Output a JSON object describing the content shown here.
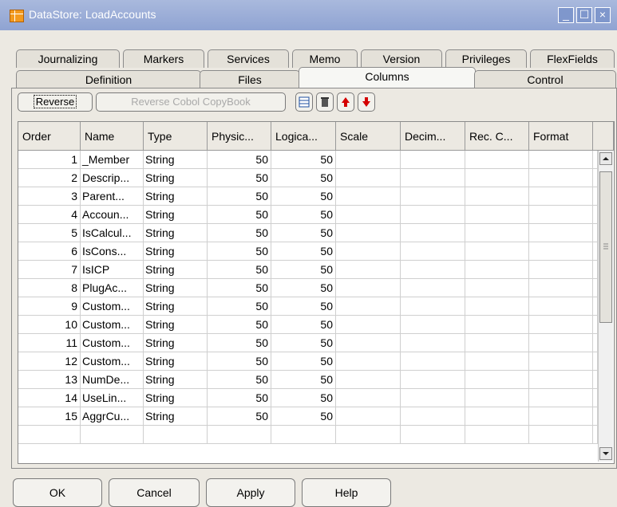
{
  "window": {
    "title": "DataStore: LoadAccounts"
  },
  "tabs_back": [
    "Journalizing",
    "Markers",
    "Services",
    "Memo",
    "Version",
    "Privileges",
    "FlexFields"
  ],
  "tabs_front": [
    "Definition",
    "Files",
    "Columns",
    "Control"
  ],
  "active_tab": "Columns",
  "toolbar": {
    "reverse_label": "Reverse",
    "reverse_cobol_label": "Reverse Cobol CopyBook"
  },
  "grid": {
    "headers": [
      "Order",
      "Name",
      "Type",
      "Physic...",
      "Logica...",
      "Scale",
      "Decim...",
      "Rec. C...",
      "Format"
    ],
    "rows": [
      [
        "1",
        "_Member",
        "String",
        "50",
        "50"
      ],
      [
        "2",
        "Descrip...",
        "String",
        "50",
        "50"
      ],
      [
        "3",
        "Parent...",
        "String",
        "50",
        "50"
      ],
      [
        "4",
        "Accoun...",
        "String",
        "50",
        "50"
      ],
      [
        "5",
        "IsCalcul...",
        "String",
        "50",
        "50"
      ],
      [
        "6",
        "IsCons...",
        "String",
        "50",
        "50"
      ],
      [
        "7",
        "IsICP",
        "String",
        "50",
        "50"
      ],
      [
        "8",
        "PlugAc...",
        "String",
        "50",
        "50"
      ],
      [
        "9",
        "Custom...",
        "String",
        "50",
        "50"
      ],
      [
        "10",
        "Custom...",
        "String",
        "50",
        "50"
      ],
      [
        "11",
        "Custom...",
        "String",
        "50",
        "50"
      ],
      [
        "12",
        "Custom...",
        "String",
        "50",
        "50"
      ],
      [
        "13",
        "NumDe...",
        "String",
        "50",
        "50"
      ],
      [
        "14",
        "UseLin...",
        "String",
        "50",
        "50"
      ],
      [
        "15",
        "AggrCu...",
        "String",
        "50",
        "50"
      ]
    ]
  },
  "buttons": {
    "ok": "OK",
    "cancel": "Cancel",
    "apply": "Apply",
    "help": "Help"
  }
}
